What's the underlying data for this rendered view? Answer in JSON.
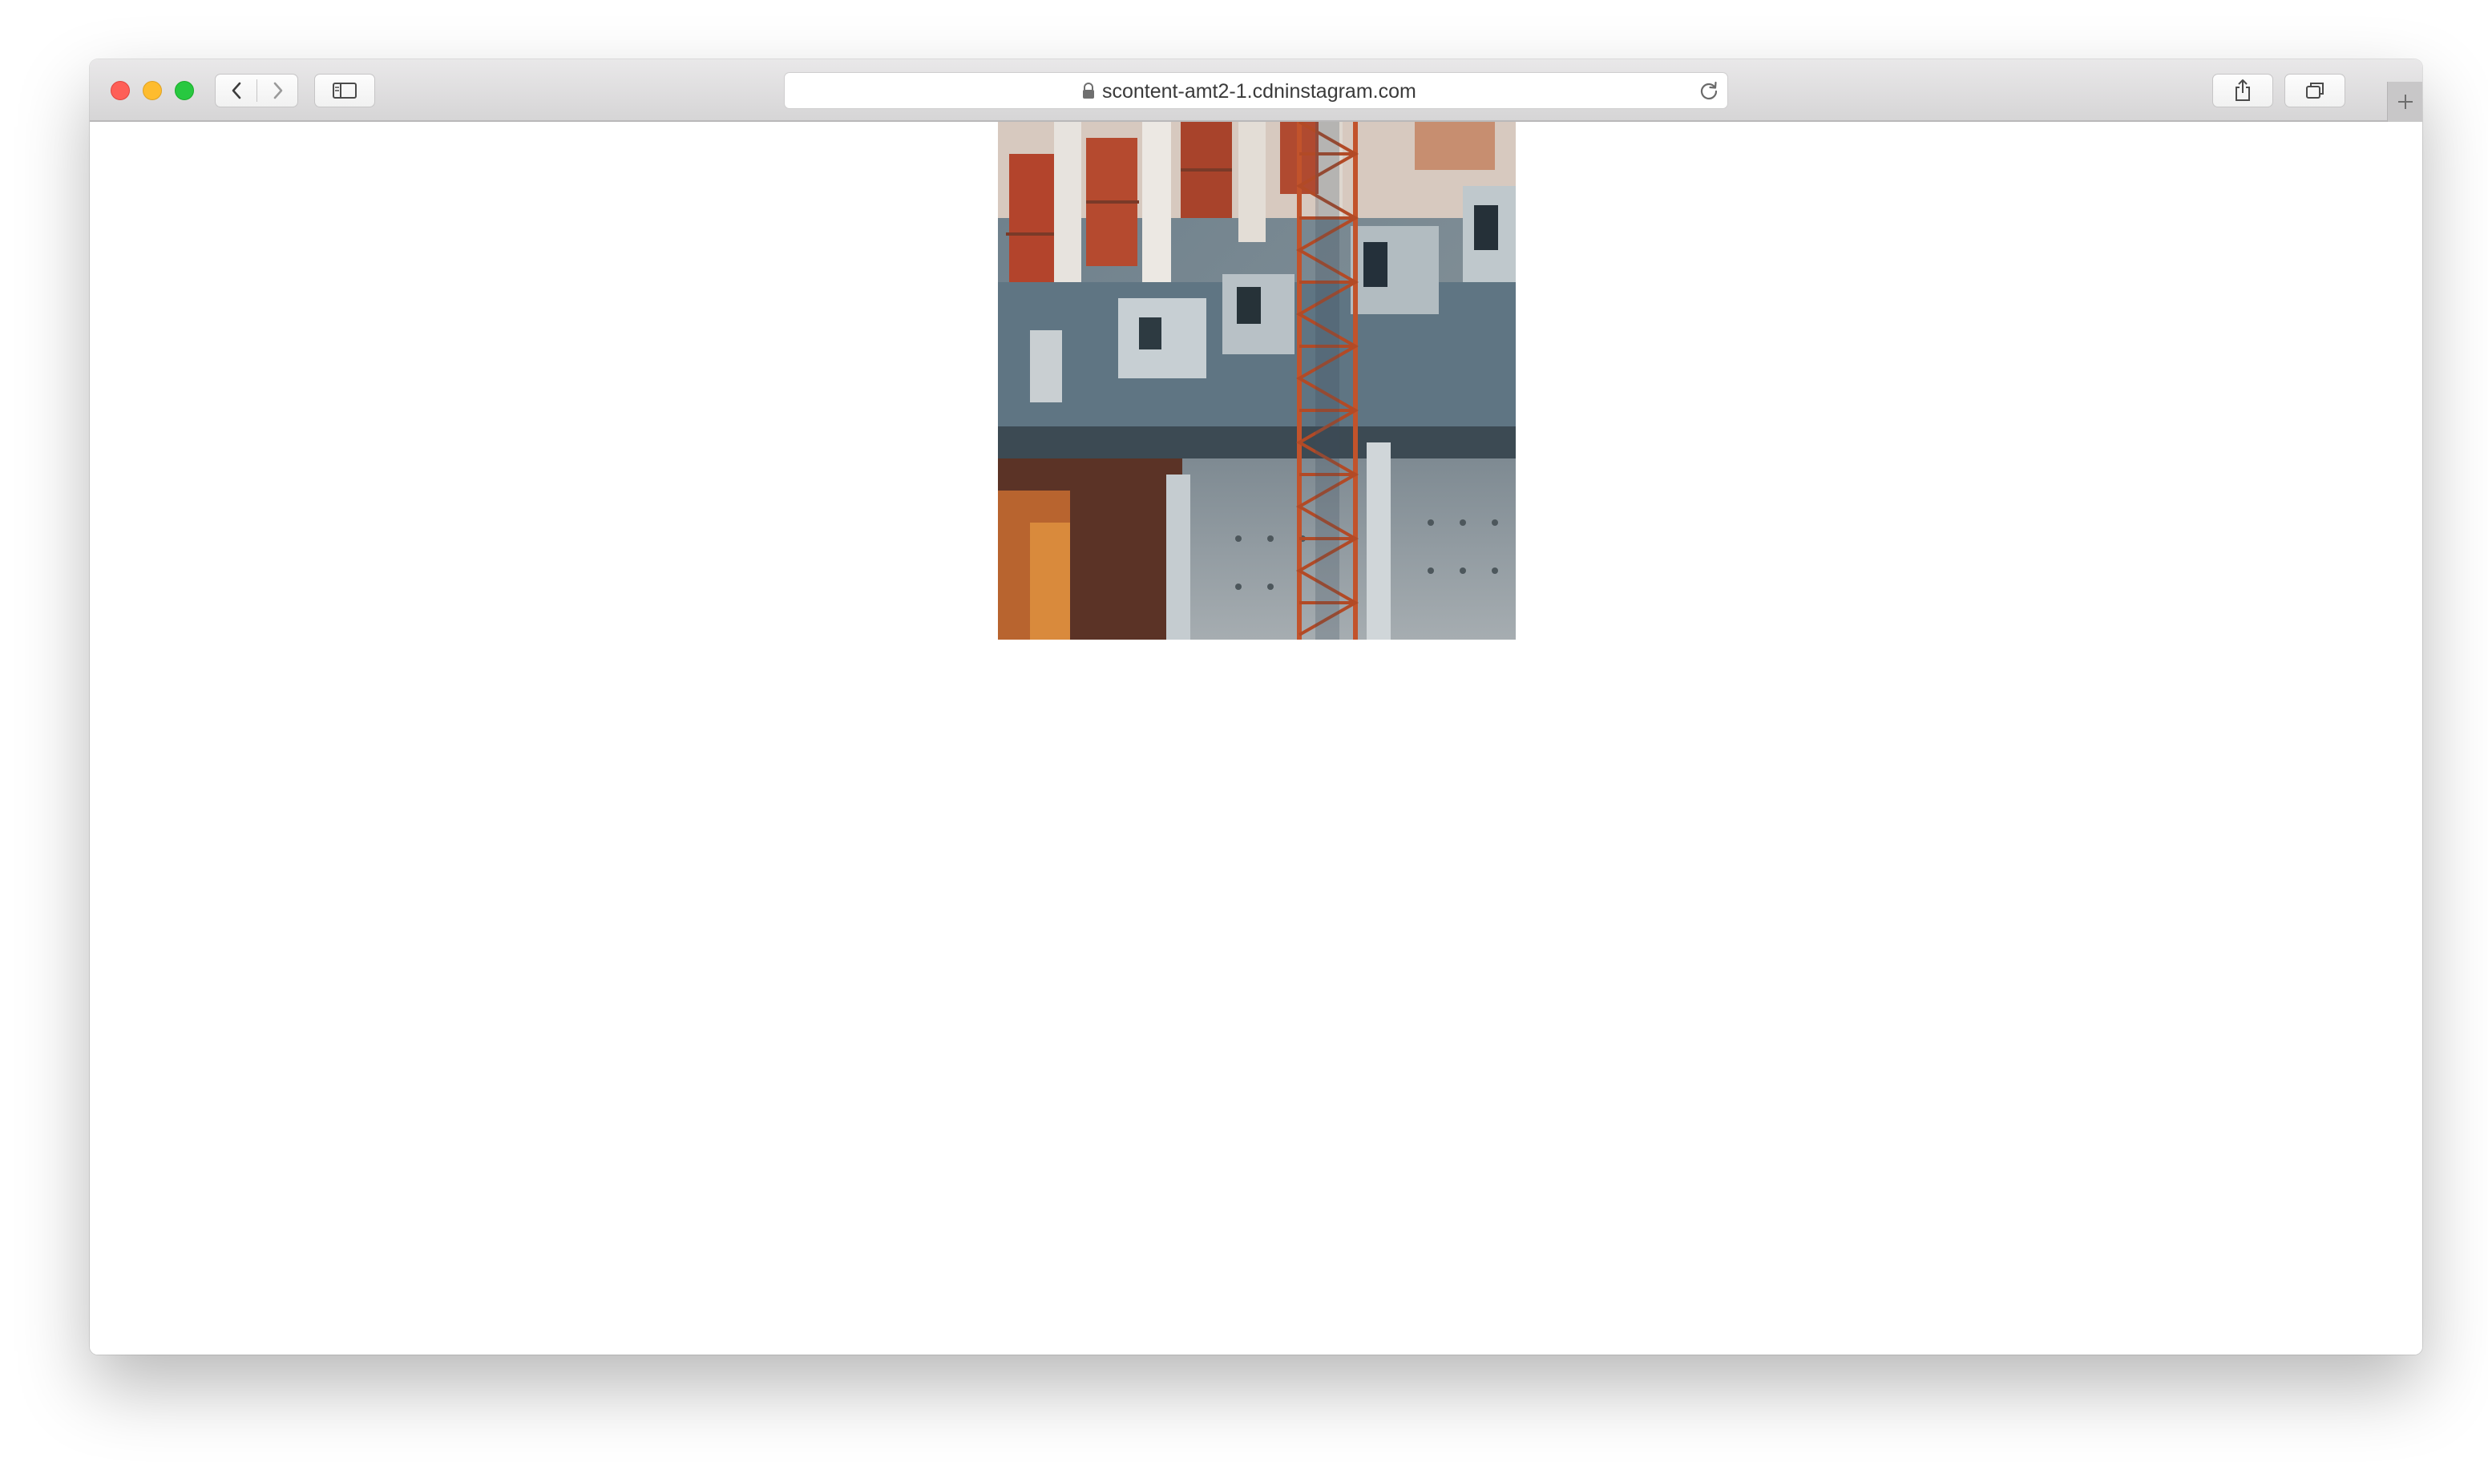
{
  "browser": {
    "url": "scontent-amt2-1.cdninstagram.com",
    "icons": {
      "back": "chevron-left-icon",
      "forward": "chevron-right-icon",
      "sidebar": "sidebar-icon",
      "lock": "lock-icon",
      "reload": "reload-icon",
      "share": "share-icon",
      "tabs": "tabs-overview-icon",
      "new_tab": "plus-icon"
    },
    "traffic_lights": {
      "close": "#fe5f57",
      "minimize": "#febc2e",
      "maximize": "#28c840"
    }
  },
  "page": {
    "image_description_name": "building-photo"
  }
}
